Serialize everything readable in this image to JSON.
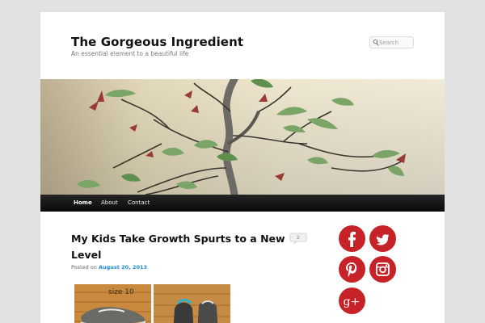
{
  "site": {
    "title": "The Gorgeous Ingredient",
    "description": "An essential element to a beautiful life"
  },
  "search": {
    "placeholder": "Search"
  },
  "nav": {
    "items": [
      {
        "label": "Home",
        "active": true
      },
      {
        "label": "About",
        "active": false
      },
      {
        "label": "Contact",
        "active": false
      }
    ]
  },
  "post": {
    "title": "My Kids Take Growth Spurts to a New Level",
    "posted_on": "Posted on",
    "date": "August 20, 2013",
    "comment_count": "2"
  },
  "social": {
    "icons": [
      "facebook-icon",
      "twitter-icon",
      "pinterest-icon",
      "instagram-icon",
      "google-plus-icon"
    ],
    "color": "#c62227"
  },
  "colors": {
    "link": "#1b8be0",
    "nav_bg": "#1a1a1a",
    "page_bg": "#e2e2e2"
  }
}
